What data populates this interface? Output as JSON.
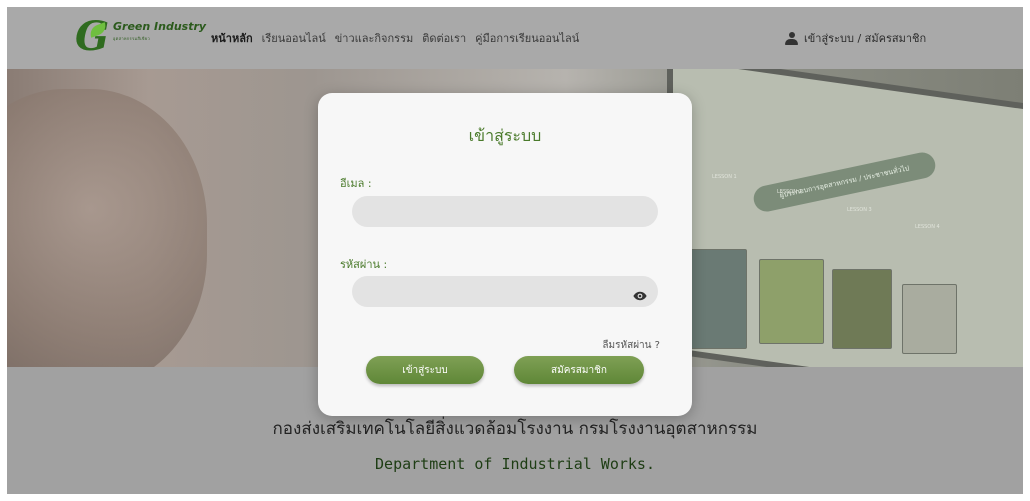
{
  "header": {
    "logo": {
      "title": "Green Industry",
      "subtitle": "อุตสาหกรรมสีเขียว"
    },
    "nav": [
      {
        "label": "หน้าหลัก",
        "active": true
      },
      {
        "label": "เรียนออนไลน์",
        "active": false
      },
      {
        "label": "ข่าวและกิจกรรม",
        "active": false
      },
      {
        "label": "ติดต่อเรา",
        "active": false
      },
      {
        "label": "คู่มือการเรียนออนไลน์",
        "active": false
      }
    ],
    "login_link": "เข้าสู่ระบบ / สมัครสมาชิก",
    "login_icon": "user-icon"
  },
  "hero": {
    "badge": "ผู้ประกอบการอุตสาหกรรม / ประชาชนทั่วไป",
    "lessons": [
      "LESSON 1",
      "LESSON 2",
      "LESSON 3",
      "LESSON 4"
    ]
  },
  "modal": {
    "title": "เข้าสู่ระบบ",
    "email_label": "อีเมล :",
    "email_value": "",
    "password_label": "รหัสผ่าน :",
    "password_value": "",
    "password_toggle_icon": "eye-icon",
    "forgot_password": "ลืมรหัสผ่าน ?",
    "login_button": "เข้าสู่ระบบ",
    "register_button": "สมัครสมาชิก"
  },
  "footer": {
    "tagline_th": "กองส่งเสริมเทคโนโลยีสิ่งแวดล้อมโรงงาน กรมโรงงานอุตสาหกรรม",
    "tagline_en": "Department of Industrial Works."
  },
  "colors": {
    "accent": "#4a7a2b",
    "button": "#6b9142",
    "overlay": "#a9a9a9"
  }
}
